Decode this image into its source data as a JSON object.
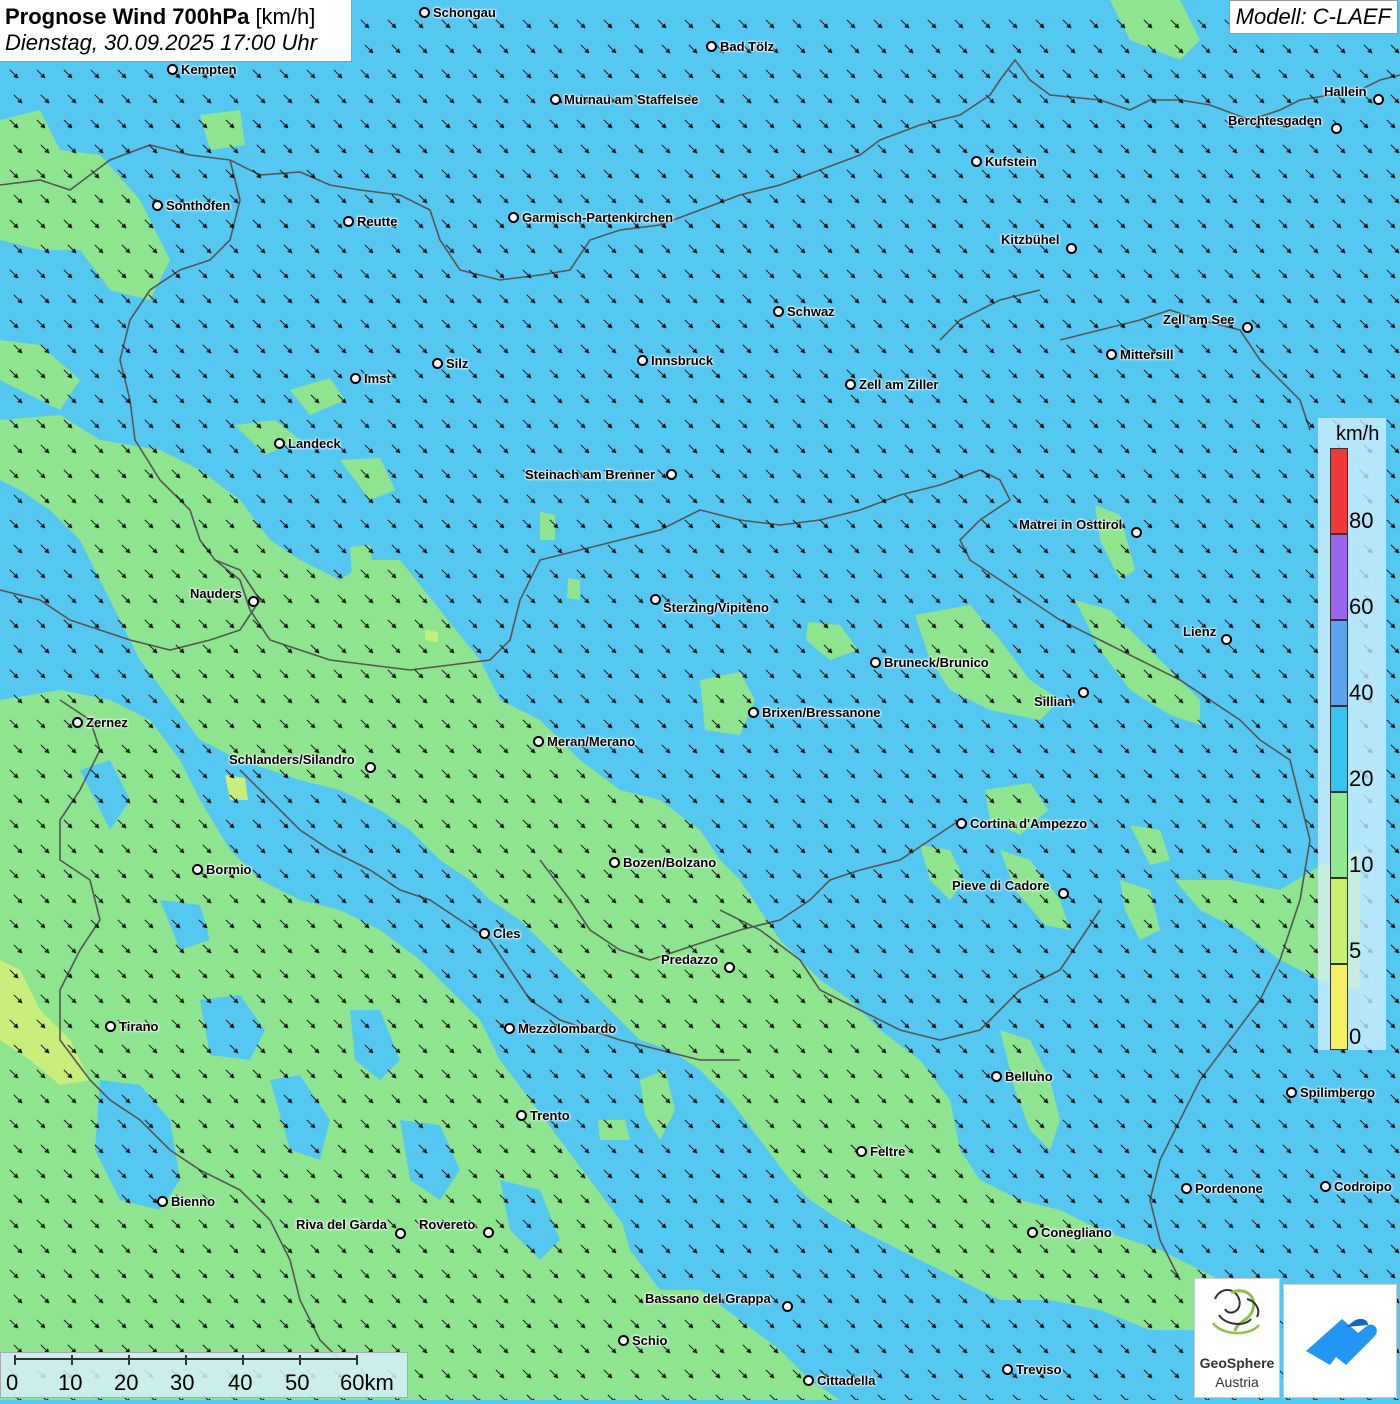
{
  "header": {
    "title_bold": "Prognose Wind 700hPa",
    "title_unit": "[km/h]",
    "datetime": "Dienstag, 30.09.2025 17:00 Uhr",
    "model": "Modell: C-LAEF"
  },
  "legend": {
    "unit": "km/h",
    "labels": [
      "0",
      "5",
      "10",
      "20",
      "40",
      "60",
      "80"
    ],
    "colors": [
      "#f5f063",
      "#c9ef6f",
      "#91e88d",
      "#38c4ef",
      "#5ea2ee",
      "#9a66ee",
      "#f03a3a"
    ]
  },
  "colors": {
    "wind_10_20": "#8fe58f",
    "wind_20_40": "#55c8f2",
    "wind_5_10": "#c8ee7c",
    "border": "#555555"
  },
  "wind": {
    "direction_deg": 315,
    "spacing": "regular grid"
  },
  "cities": [
    {
      "name": "Schongau"
    },
    {
      "name": "Bad Tölz"
    },
    {
      "name": "Kempten"
    },
    {
      "name": "Murnau am Staffelsee"
    },
    {
      "name": "Hallein"
    },
    {
      "name": "Berchtesgaden"
    },
    {
      "name": "Kufstein"
    },
    {
      "name": "Sonthofen"
    },
    {
      "name": "Reutte"
    },
    {
      "name": "Garmisch-Partenkirchen"
    },
    {
      "name": "Kitzbühel"
    },
    {
      "name": "Schwaz"
    },
    {
      "name": "Zell am See"
    },
    {
      "name": "Mittersill"
    },
    {
      "name": "Innsbruck"
    },
    {
      "name": "Silz"
    },
    {
      "name": "Imst"
    },
    {
      "name": "Zell am Ziller"
    },
    {
      "name": "Landeck"
    },
    {
      "name": "Steinach am Brenner"
    },
    {
      "name": "Matrei in Osttirol"
    },
    {
      "name": "Nauders"
    },
    {
      "name": "Sterzing/Vipiteno"
    },
    {
      "name": "Lienz"
    },
    {
      "name": "Bruneck/Brunico"
    },
    {
      "name": "Sillian"
    },
    {
      "name": "Brixen/Bressanone"
    },
    {
      "name": "Zernez"
    },
    {
      "name": "Meran/Merano"
    },
    {
      "name": "Schlanders/Silandro"
    },
    {
      "name": "Cortina d'Ampezzo"
    },
    {
      "name": "Bozen/Bolzano"
    },
    {
      "name": "Bormio"
    },
    {
      "name": "Pieve di Cadore"
    },
    {
      "name": "Cles"
    },
    {
      "name": "Predazzo"
    },
    {
      "name": "Tirano"
    },
    {
      "name": "Mezzolombardo"
    },
    {
      "name": "Belluno"
    },
    {
      "name": "Spilimbergo"
    },
    {
      "name": "Trento"
    },
    {
      "name": "Feltre"
    },
    {
      "name": "Pordenone"
    },
    {
      "name": "Codroipo"
    },
    {
      "name": "Bienno"
    },
    {
      "name": "Riva del Garda"
    },
    {
      "name": "Rovereto"
    },
    {
      "name": "Conegliano"
    },
    {
      "name": "Bassano del Grappa"
    },
    {
      "name": "Schio"
    },
    {
      "name": "Treviso"
    },
    {
      "name": "Cittadella"
    }
  ],
  "scale": {
    "labels": [
      "0",
      "10",
      "20",
      "30",
      "40",
      "50",
      "60km"
    ]
  },
  "logos": {
    "geosphere_line1": "GeoSphere",
    "geosphere_line2": "Austria"
  }
}
